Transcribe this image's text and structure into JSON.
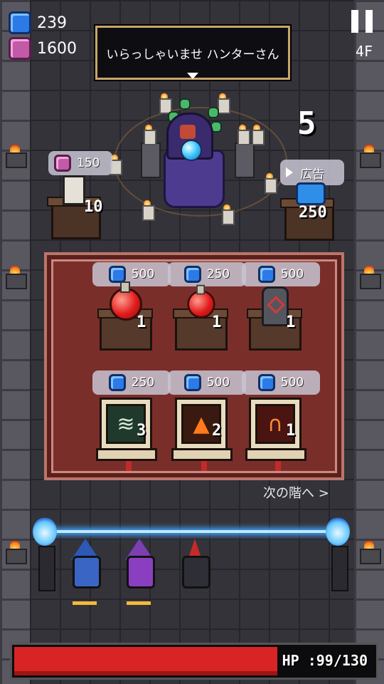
{
  "hud": {
    "blue_gems": "239",
    "pink_gems": "1600",
    "floor": "4F"
  },
  "dialog": {
    "text": "いらっしゃいませ ハンターさん"
  },
  "counter": "5",
  "side_items": {
    "left": {
      "price": "150",
      "currency": "pink-gem",
      "quantity": "10",
      "icon": "candle-statue-icon"
    },
    "right": {
      "label": "広告",
      "quantity": "250",
      "icon": "blue-gem-pile-icon"
    }
  },
  "shop_items": [
    {
      "price": "500",
      "currency": "blue-gem",
      "quantity": "1",
      "item": "red-potion"
    },
    {
      "price": "250",
      "currency": "blue-gem",
      "quantity": "1",
      "item": "small-red-potion"
    },
    {
      "price": "500",
      "currency": "blue-gem",
      "quantity": "1",
      "item": "rune-stone"
    },
    {
      "price": "250",
      "currency": "blue-gem",
      "quantity": "3",
      "item": "tornado-scroll"
    },
    {
      "price": "500",
      "currency": "blue-gem",
      "quantity": "2",
      "item": "fire-scroll"
    },
    {
      "price": "500",
      "currency": "blue-gem",
      "quantity": "1",
      "item": "arch-scroll"
    }
  ],
  "next_floor": "次の階へ >",
  "hp": {
    "text": "HP :99/130",
    "current": 99,
    "max": 130
  },
  "colors": {
    "hp_fill": "#d82424",
    "carpet": "#7a2e2a",
    "blue_gem": "#2c7ae8",
    "pink_gem": "#c25aa8"
  }
}
